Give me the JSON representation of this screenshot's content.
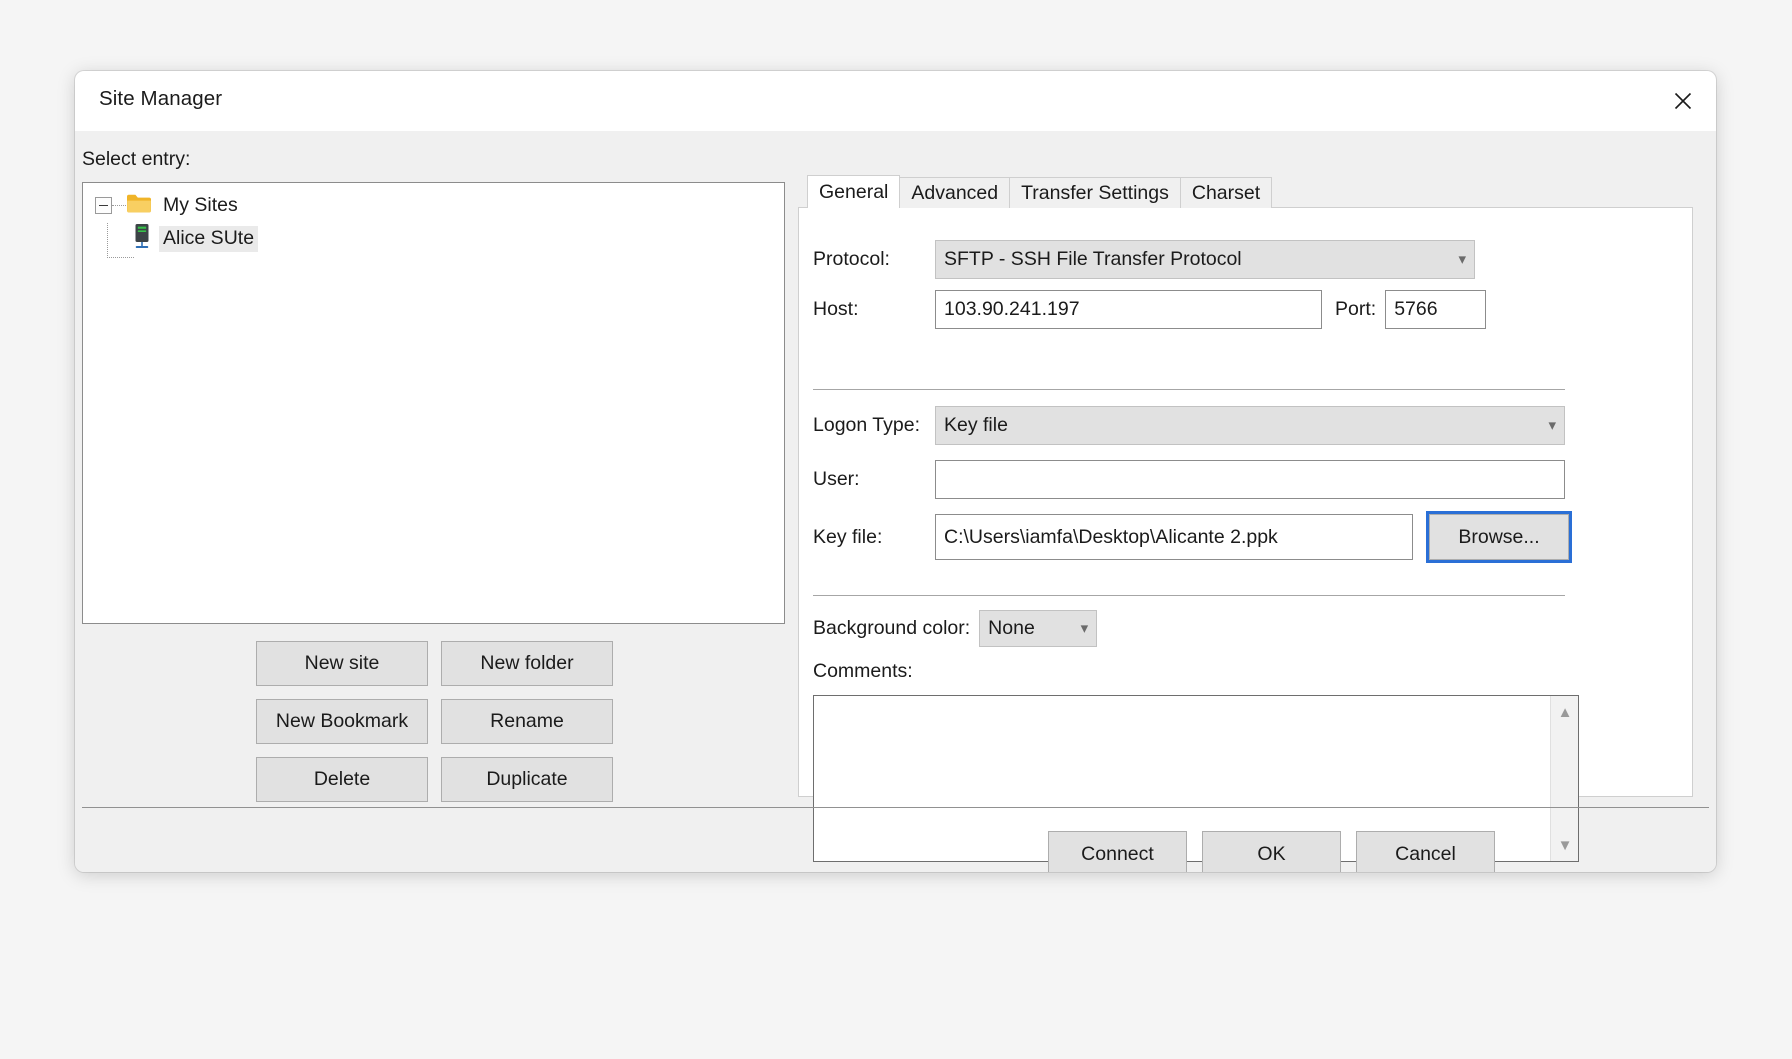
{
  "window": {
    "title": "Site Manager",
    "close_icon": "close-icon"
  },
  "left_pane": {
    "select_entry_label": "Select entry:",
    "tree": {
      "root": {
        "label": "My Sites",
        "icon": "folder-icon",
        "expanded": true
      },
      "children": [
        {
          "label": "Alice SUte",
          "icon": "server-icon",
          "selected": true
        }
      ]
    },
    "buttons": [
      "New site",
      "New folder",
      "New Bookmark",
      "Rename",
      "Delete",
      "Duplicate"
    ]
  },
  "right_pane": {
    "tabs": [
      {
        "label": "General",
        "active": true
      },
      {
        "label": "Advanced",
        "active": false
      },
      {
        "label": "Transfer Settings",
        "active": false
      },
      {
        "label": "Charset",
        "active": false
      }
    ],
    "fields": {
      "protocol_label": "Protocol:",
      "protocol_value": "SFTP - SSH File Transfer Protocol",
      "host_label": "Host:",
      "host_value": "103.90.241.197",
      "port_label": "Port:",
      "port_value": "5766",
      "logon_type_label": "Logon Type:",
      "logon_type_value": "Key file",
      "user_label": "User:",
      "user_value": "",
      "key_file_label": "Key file:",
      "key_file_value": "C:\\Users\\iamfa\\Desktop\\Alicante 2.ppk",
      "browse_label": "Browse...",
      "background_color_label": "Background color:",
      "background_color_value": "None",
      "comments_label": "Comments:",
      "comments_value": ""
    }
  },
  "footer": {
    "buttons": [
      "Connect",
      "OK",
      "Cancel"
    ]
  },
  "colors": {
    "dialog_bg": "#f0f0f0",
    "titlebar_bg": "#ffffff",
    "field_bg": "#ffffff",
    "combo_bg": "#e1e1e1",
    "button_bg": "#e1e1e1",
    "focus_ring": "#2a6fd6",
    "folder": "#f5c344",
    "text": "#1b1b1b"
  }
}
